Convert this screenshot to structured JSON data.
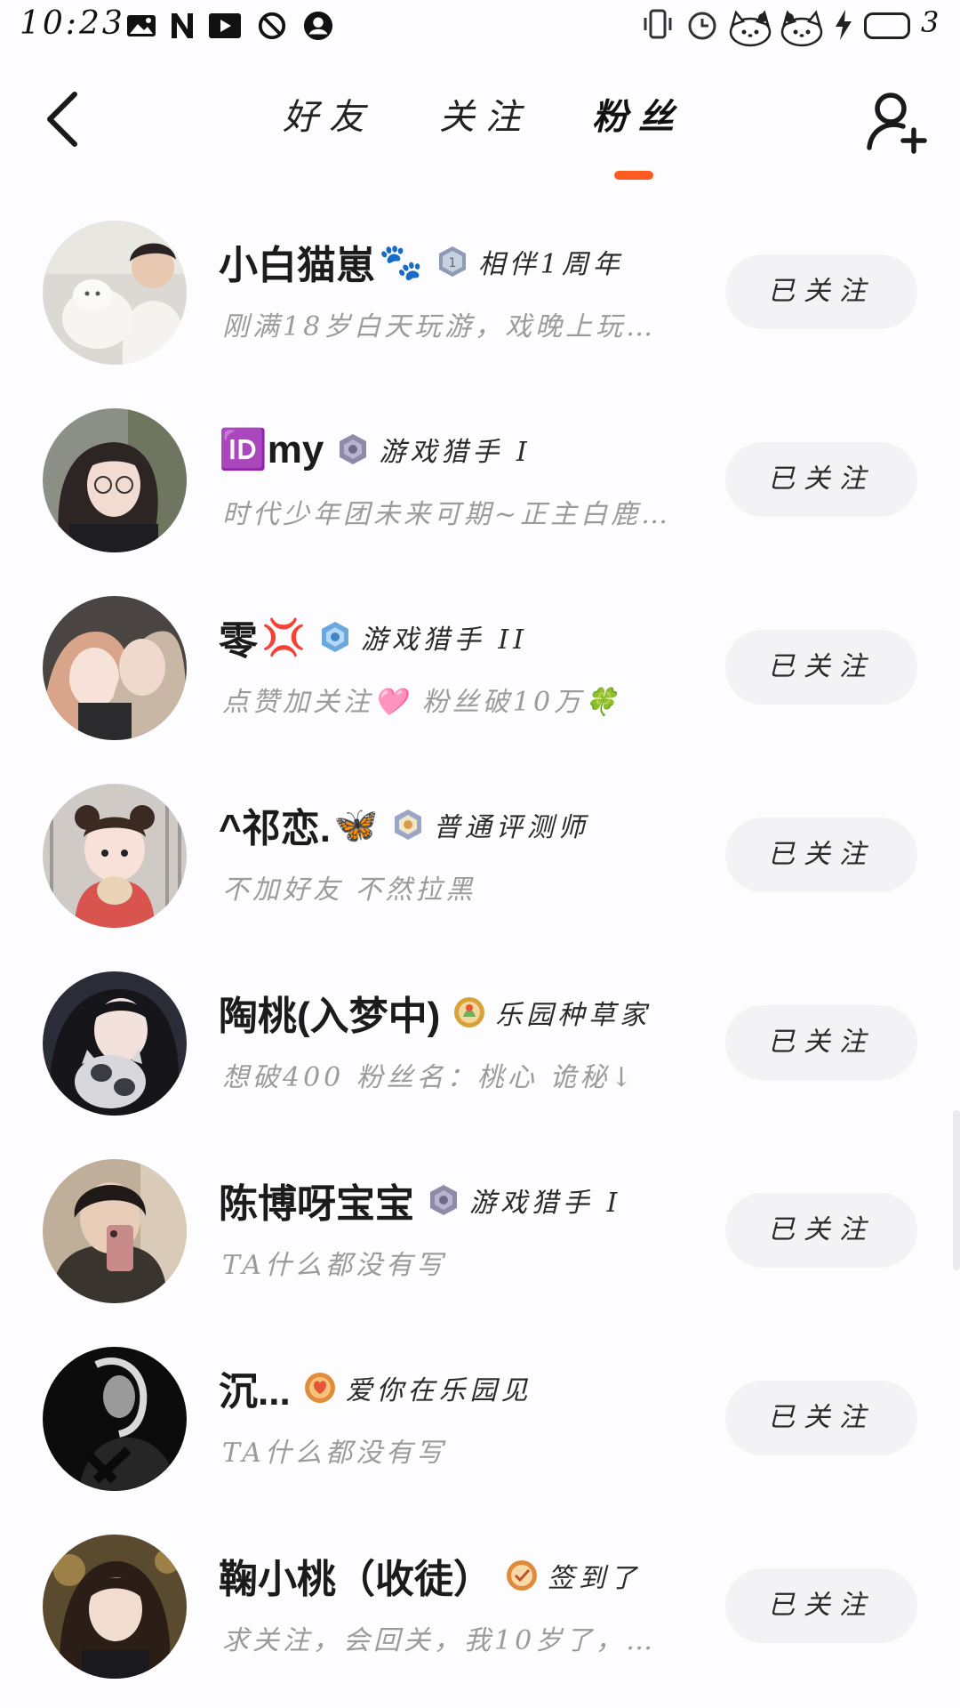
{
  "status_bar": {
    "time": "10:23",
    "battery_level": "3",
    "left_icons": [
      "image-notification-icon",
      "n-app-icon",
      "video-play-icon",
      "do-not-disturb-icon",
      "profile-icon"
    ],
    "right_icons": [
      "vibrate-icon",
      "alarm-icon",
      "hello-kitty-sticker-icon",
      "hello-kitty-sticker-icon",
      "charging-bolt-icon",
      "battery-icon"
    ]
  },
  "header": {
    "tabs": [
      {
        "label": "好友",
        "active": false
      },
      {
        "label": "关注",
        "active": false
      },
      {
        "label": "粉丝",
        "active": true
      }
    ],
    "accent_color": "#ff5a1f"
  },
  "fans": [
    {
      "name": "小白猫崽",
      "emoji": "🐾",
      "badge_icon": "anniversary-badge-icon",
      "badge_color": "#8e9bb7",
      "badge": "相伴1周年",
      "bio": "刚满18岁白天玩游，戏晚上玩…",
      "button": "已关注",
      "avatar_icon": "boy-holding-cat-avatar"
    },
    {
      "name": "🆔my",
      "emoji": "",
      "badge_icon": "game-hunter-badge-icon",
      "badge_color": "#8f8aa8",
      "badge": "游戏猎手 I",
      "bio": "时代少年团未来可期~正主白鹿…",
      "button": "已关注",
      "avatar_icon": "girl-with-glasses-avatar"
    },
    {
      "name": "零",
      "emoji": "💢",
      "badge_icon": "game-hunter-badge-icon",
      "badge_color": "#6aa8e0",
      "badge": "游戏猎手 II",
      "bio": "点赞加关注🩷 粉丝破10万🍀",
      "button": "已关注",
      "avatar_icon": "couple-selfie-avatar"
    },
    {
      "name": "^祁恋.",
      "emoji": "🦋",
      "badge_icon": "reviewer-badge-icon",
      "badge_color": "#9aa6c7",
      "badge": "普通评测师",
      "bio": "不加好友 不然拉黑",
      "button": "已关注",
      "avatar_icon": "baby-girl-avatar"
    },
    {
      "name": "陶桃(入梦中)",
      "emoji": "",
      "badge_icon": "garden-badge-icon",
      "badge_color": "#d8a23a",
      "badge": "乐园种草家",
      "bio": "想破400 粉丝名：桃心 诡秘↓",
      "button": "已关注",
      "avatar_icon": "girl-with-cat-avatar"
    },
    {
      "name": "陈博呀宝宝",
      "emoji": "",
      "badge_icon": "game-hunter-badge-icon",
      "badge_color": "#8f8aa8",
      "badge": "游戏猎手 I",
      "bio": "TA什么都没有写",
      "button": "已关注",
      "avatar_icon": "mirror-selfie-avatar"
    },
    {
      "name": "沉...",
      "emoji": "",
      "badge_icon": "garden-badge-icon",
      "badge_color": "#e08a3c",
      "badge": "爱你在乐园见",
      "bio": "TA什么都没有写",
      "button": "已关注",
      "avatar_icon": "dark-silhouette-avatar"
    },
    {
      "name": "鞠小桃（收徒）",
      "emoji": "",
      "badge_icon": "check-in-badge-icon",
      "badge_color": "#e08a3c",
      "badge": "签到了",
      "bio": "求关注，会回关，我10岁了，…",
      "button": "已关注",
      "avatar_icon": "girl-portrait-avatar"
    }
  ]
}
